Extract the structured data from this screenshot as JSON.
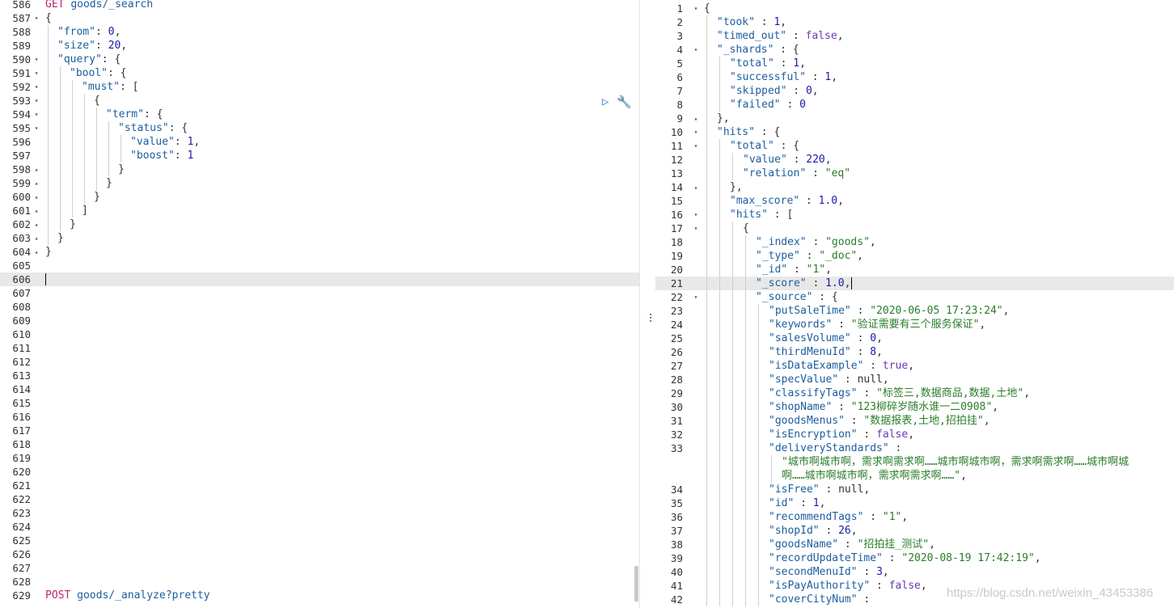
{
  "request_editor": {
    "lines": [
      {
        "num": "586",
        "fold": "",
        "indent": 0,
        "html": "<span class='m'>GET</span> <span class='k'>goods/_search</span>"
      },
      {
        "num": "587",
        "fold": "▾",
        "indent": 0,
        "html": "<span class='p'>{</span>"
      },
      {
        "num": "588",
        "fold": "",
        "indent": 1,
        "html": "<span class='k'>\"from\"</span><span class='p'>: </span><span class='n'>0</span><span class='p'>,</span>"
      },
      {
        "num": "589",
        "fold": "",
        "indent": 1,
        "html": "<span class='k'>\"size\"</span><span class='p'>: </span><span class='n'>20</span><span class='p'>,</span>"
      },
      {
        "num": "590",
        "fold": "▾",
        "indent": 1,
        "html": "<span class='k'>\"query\"</span><span class='p'>: {</span>"
      },
      {
        "num": "591",
        "fold": "▾",
        "indent": 2,
        "html": "<span class='k'>\"bool\"</span><span class='p'>: {</span>"
      },
      {
        "num": "592",
        "fold": "▾",
        "indent": 3,
        "html": "<span class='k'>\"must\"</span><span class='p'>: [</span>"
      },
      {
        "num": "593",
        "fold": "▾",
        "indent": 4,
        "html": "<span class='p'>{</span>"
      },
      {
        "num": "594",
        "fold": "▾",
        "indent": 5,
        "html": "<span class='k'>\"term\"</span><span class='p'>: {</span>"
      },
      {
        "num": "595",
        "fold": "▾",
        "indent": 6,
        "html": "<span class='k'>\"status\"</span><span class='p'>: {</span>"
      },
      {
        "num": "596",
        "fold": "",
        "indent": 7,
        "html": "<span class='k'>\"value\"</span><span class='p'>: </span><span class='n'>1</span><span class='p'>,</span>"
      },
      {
        "num": "597",
        "fold": "",
        "indent": 7,
        "html": "<span class='k'>\"boost\"</span><span class='p'>: </span><span class='n'>1</span>"
      },
      {
        "num": "598",
        "fold": "▴",
        "indent": 6,
        "html": "<span class='p'>}</span>"
      },
      {
        "num": "599",
        "fold": "▴",
        "indent": 5,
        "html": "<span class='p'>}</span>"
      },
      {
        "num": "600",
        "fold": "▴",
        "indent": 4,
        "html": "<span class='p'>}</span>"
      },
      {
        "num": "601",
        "fold": "▴",
        "indent": 3,
        "html": "<span class='p'>]</span>"
      },
      {
        "num": "602",
        "fold": "▴",
        "indent": 2,
        "html": "<span class='p'>}</span>"
      },
      {
        "num": "603",
        "fold": "▴",
        "indent": 1,
        "html": "<span class='p'>}</span>"
      },
      {
        "num": "604",
        "fold": "▴",
        "indent": 0,
        "html": "<span class='p'>}</span>"
      },
      {
        "num": "605",
        "fold": "",
        "indent": 0,
        "html": ""
      },
      {
        "num": "606",
        "fold": "",
        "indent": 0,
        "html": "",
        "active": true
      },
      {
        "num": "607",
        "fold": "",
        "indent": 0,
        "html": ""
      },
      {
        "num": "608",
        "fold": "",
        "indent": 0,
        "html": ""
      },
      {
        "num": "609",
        "fold": "",
        "indent": 0,
        "html": ""
      },
      {
        "num": "610",
        "fold": "",
        "indent": 0,
        "html": ""
      },
      {
        "num": "611",
        "fold": "",
        "indent": 0,
        "html": ""
      },
      {
        "num": "612",
        "fold": "",
        "indent": 0,
        "html": ""
      },
      {
        "num": "613",
        "fold": "",
        "indent": 0,
        "html": ""
      },
      {
        "num": "614",
        "fold": "",
        "indent": 0,
        "html": ""
      },
      {
        "num": "615",
        "fold": "",
        "indent": 0,
        "html": ""
      },
      {
        "num": "616",
        "fold": "",
        "indent": 0,
        "html": ""
      },
      {
        "num": "617",
        "fold": "",
        "indent": 0,
        "html": ""
      },
      {
        "num": "618",
        "fold": "",
        "indent": 0,
        "html": ""
      },
      {
        "num": "619",
        "fold": "",
        "indent": 0,
        "html": ""
      },
      {
        "num": "620",
        "fold": "",
        "indent": 0,
        "html": ""
      },
      {
        "num": "621",
        "fold": "",
        "indent": 0,
        "html": ""
      },
      {
        "num": "622",
        "fold": "",
        "indent": 0,
        "html": ""
      },
      {
        "num": "623",
        "fold": "",
        "indent": 0,
        "html": ""
      },
      {
        "num": "624",
        "fold": "",
        "indent": 0,
        "html": ""
      },
      {
        "num": "625",
        "fold": "",
        "indent": 0,
        "html": ""
      },
      {
        "num": "626",
        "fold": "",
        "indent": 0,
        "html": ""
      },
      {
        "num": "627",
        "fold": "",
        "indent": 0,
        "html": ""
      },
      {
        "num": "628",
        "fold": "",
        "indent": 0,
        "html": ""
      },
      {
        "num": "629",
        "fold": "",
        "indent": 0,
        "html": "<span class='m'>POST</span> <span class='k'>goods/_analyze?pretty</span>"
      }
    ]
  },
  "response_viewer": {
    "lines": [
      {
        "num": "1",
        "fold": "▾",
        "indent": 0,
        "html": "<span class='p'>{</span>"
      },
      {
        "num": "2",
        "fold": "",
        "indent": 1,
        "html": "<span class='k'>\"took\"</span><span class='p'> : </span><span class='n'>1</span><span class='p'>,</span>"
      },
      {
        "num": "3",
        "fold": "",
        "indent": 1,
        "html": "<span class='k'>\"timed_out\"</span><span class='p'> : </span><span class='b'>false</span><span class='p'>,</span>"
      },
      {
        "num": "4",
        "fold": "▾",
        "indent": 1,
        "html": "<span class='k'>\"_shards\"</span><span class='p'> : {</span>"
      },
      {
        "num": "5",
        "fold": "",
        "indent": 2,
        "html": "<span class='k'>\"total\"</span><span class='p'> : </span><span class='n'>1</span><span class='p'>,</span>"
      },
      {
        "num": "6",
        "fold": "",
        "indent": 2,
        "html": "<span class='k'>\"successful\"</span><span class='p'> : </span><span class='n'>1</span><span class='p'>,</span>"
      },
      {
        "num": "7",
        "fold": "",
        "indent": 2,
        "html": "<span class='k'>\"skipped\"</span><span class='p'> : </span><span class='n'>0</span><span class='p'>,</span>"
      },
      {
        "num": "8",
        "fold": "",
        "indent": 2,
        "html": "<span class='k'>\"failed\"</span><span class='p'> : </span><span class='n'>0</span>"
      },
      {
        "num": "9",
        "fold": "▴",
        "indent": 1,
        "html": "<span class='p'>},</span>"
      },
      {
        "num": "10",
        "fold": "▾",
        "indent": 1,
        "html": "<span class='k'>\"hits\"</span><span class='p'> : {</span>"
      },
      {
        "num": "11",
        "fold": "▾",
        "indent": 2,
        "html": "<span class='k'>\"total\"</span><span class='p'> : {</span>"
      },
      {
        "num": "12",
        "fold": "",
        "indent": 3,
        "html": "<span class='k'>\"value\"</span><span class='p'> : </span><span class='n'>220</span><span class='p'>,</span>"
      },
      {
        "num": "13",
        "fold": "",
        "indent": 3,
        "html": "<span class='k'>\"relation\"</span><span class='p'> : </span><span class='s'>\"eq\"</span>"
      },
      {
        "num": "14",
        "fold": "▴",
        "indent": 2,
        "html": "<span class='p'>},</span>"
      },
      {
        "num": "15",
        "fold": "",
        "indent": 2,
        "html": "<span class='k'>\"max_score\"</span><span class='p'> : </span><span class='n'>1.0</span><span class='p'>,</span>"
      },
      {
        "num": "16",
        "fold": "▾",
        "indent": 2,
        "html": "<span class='k'>\"hits\"</span><span class='p'> : [</span>"
      },
      {
        "num": "17",
        "fold": "▾",
        "indent": 3,
        "html": "<span class='p'>{</span>"
      },
      {
        "num": "18",
        "fold": "",
        "indent": 4,
        "html": "<span class='k'>\"_index\"</span><span class='p'> : </span><span class='s'>\"goods\"</span><span class='p'>,</span>"
      },
      {
        "num": "19",
        "fold": "",
        "indent": 4,
        "html": "<span class='k'>\"_type\"</span><span class='p'> : </span><span class='s'>\"_doc\"</span><span class='p'>,</span>"
      },
      {
        "num": "20",
        "fold": "",
        "indent": 4,
        "html": "<span class='k'>\"_id\"</span><span class='p'> : </span><span class='s'>\"1\"</span><span class='p'>,</span>"
      },
      {
        "num": "21",
        "fold": "",
        "indent": 4,
        "html": "<span class='k'>\"_score\"</span><span class='p'> : </span><span class='n'>1.0</span><span class='p'>,</span>",
        "active": true
      },
      {
        "num": "22",
        "fold": "▾",
        "indent": 4,
        "html": "<span class='k'>\"_source\"</span><span class='p'> : {</span>"
      },
      {
        "num": "23",
        "fold": "",
        "indent": 5,
        "html": "<span class='k'>\"putSaleTime\"</span><span class='p'> : </span><span class='s'>\"2020-06-05 17:23:24\"</span><span class='p'>,</span>"
      },
      {
        "num": "24",
        "fold": "",
        "indent": 5,
        "html": "<span class='k'>\"keywords\"</span><span class='p'> : </span><span class='s'>\"验证需要有三个服务保证\"</span><span class='p'>,</span>"
      },
      {
        "num": "25",
        "fold": "",
        "indent": 5,
        "html": "<span class='k'>\"salesVolume\"</span><span class='p'> : </span><span class='n'>0</span><span class='p'>,</span>"
      },
      {
        "num": "26",
        "fold": "",
        "indent": 5,
        "html": "<span class='k'>\"thirdMenuId\"</span><span class='p'> : </span><span class='n'>8</span><span class='p'>,</span>"
      },
      {
        "num": "27",
        "fold": "",
        "indent": 5,
        "html": "<span class='k'>\"isDataExample\"</span><span class='p'> : </span><span class='b'>true</span><span class='p'>,</span>"
      },
      {
        "num": "28",
        "fold": "",
        "indent": 5,
        "html": "<span class='k'>\"specValue\"</span><span class='p'> : </span><span class='u'>null</span><span class='p'>,</span>"
      },
      {
        "num": "29",
        "fold": "",
        "indent": 5,
        "html": "<span class='k'>\"classifyTags\"</span><span class='p'> : </span><span class='s'>\"标签三,数据商品,数据,土地\"</span><span class='p'>,</span>"
      },
      {
        "num": "30",
        "fold": "",
        "indent": 5,
        "html": "<span class='k'>\"shopName\"</span><span class='p'> : </span><span class='s'>\"123柳碎岁随水谁一二0908\"</span><span class='p'>,</span>"
      },
      {
        "num": "31",
        "fold": "",
        "indent": 5,
        "html": "<span class='k'>\"goodsMenus\"</span><span class='p'> : </span><span class='s'>\"数据报表,土地,招拍挂\"</span><span class='p'>,</span>"
      },
      {
        "num": "32",
        "fold": "",
        "indent": 5,
        "html": "<span class='k'>\"isEncryption\"</span><span class='p'> : </span><span class='b'>false</span><span class='p'>,</span>"
      },
      {
        "num": "33",
        "fold": "",
        "indent": 5,
        "html": "<span class='k'>\"deliveryStandards\"</span><span class='p'> :</span>"
      },
      {
        "num": "",
        "fold": "",
        "indent": 6,
        "html": "<span class='s'>\"城市啊城市啊，需求啊需求啊……城市啊城市啊，需求啊需求啊……城市啊城</span>"
      },
      {
        "num": "",
        "fold": "",
        "indent": 6,
        "html": "<span class='s'>啊……城市啊城市啊，需求啊需求啊……\"</span><span class='p'>,</span>"
      },
      {
        "num": "34",
        "fold": "",
        "indent": 5,
        "html": "<span class='k'>\"isFree\"</span><span class='p'> : </span><span class='u'>null</span><span class='p'>,</span>"
      },
      {
        "num": "35",
        "fold": "",
        "indent": 5,
        "html": "<span class='k'>\"id\"</span><span class='p'> : </span><span class='n'>1</span><span class='p'>,</span>"
      },
      {
        "num": "36",
        "fold": "",
        "indent": 5,
        "html": "<span class='k'>\"recommendTags\"</span><span class='p'> : </span><span class='s'>\"1\"</span><span class='p'>,</span>"
      },
      {
        "num": "37",
        "fold": "",
        "indent": 5,
        "html": "<span class='k'>\"shopId\"</span><span class='p'> : </span><span class='n'>26</span><span class='p'>,</span>"
      },
      {
        "num": "38",
        "fold": "",
        "indent": 5,
        "html": "<span class='k'>\"goodsName\"</span><span class='p'> : </span><span class='s'>\"招拍挂_测试\"</span><span class='p'>,</span>"
      },
      {
        "num": "39",
        "fold": "",
        "indent": 5,
        "html": "<span class='k'>\"recordUpdateTime\"</span><span class='p'> : </span><span class='s'>\"2020-08-19 17:42:19\"</span><span class='p'>,</span>"
      },
      {
        "num": "40",
        "fold": "",
        "indent": 5,
        "html": "<span class='k'>\"secondMenuId\"</span><span class='p'> : </span><span class='n'>3</span><span class='p'>,</span>"
      },
      {
        "num": "41",
        "fold": "",
        "indent": 5,
        "html": "<span class='k'>\"isPayAuthority\"</span><span class='p'> : </span><span class='b'>false</span><span class='p'>,</span>"
      },
      {
        "num": "42",
        "fold": "",
        "indent": 5,
        "html": "<span class='k'>\"coverCityNum\"</span><span class='p'> :</span>"
      }
    ]
  },
  "icons": {
    "run": "play-icon",
    "settings": "wrench-icon",
    "divider": "vertical-ellipsis-icon"
  },
  "watermark": "https://blog.csdn.net/weixin_43453386",
  "colors": {
    "key": "#1c5d9e",
    "string": "#2a7d2a",
    "number": "#1a1aa6",
    "boolean": "#6b38b5",
    "method": "#c0246c",
    "action_icon": "#2b76d3"
  }
}
